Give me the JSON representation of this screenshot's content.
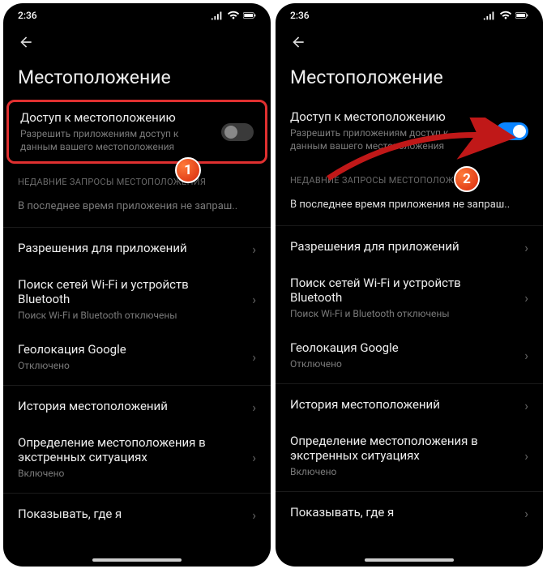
{
  "status": {
    "time": "2:36"
  },
  "page": {
    "title": "Местоположение"
  },
  "locationAccess": {
    "title": "Доступ к местоположению",
    "subtitle": "Разрешить приложениям доступ к данным вашего местоположения"
  },
  "sectionRecent": {
    "label": "НЕДАВНИЕ ЗАПРОСЫ МЕСТОПОЛОЖЕНИЯ",
    "empty": "В последнее время приложения не запраш.."
  },
  "rows": {
    "appPerms": {
      "title": "Разрешения для приложений"
    },
    "scanning": {
      "title": "Поиск сетей Wi-Fi и устройств Bluetooth",
      "sub": "Поиск Wi-Fi и Bluetooth отключены"
    },
    "googleLoc": {
      "title": "Геолокация Google",
      "sub": "Отключено"
    },
    "history": {
      "title": "История местоположений"
    },
    "emergency": {
      "title": "Определение местоположения в экстренных ситуациях",
      "sub": "Включено"
    },
    "showWhere": {
      "title": "Показывать, где я"
    }
  },
  "badges": {
    "one": "1",
    "two": "2"
  }
}
